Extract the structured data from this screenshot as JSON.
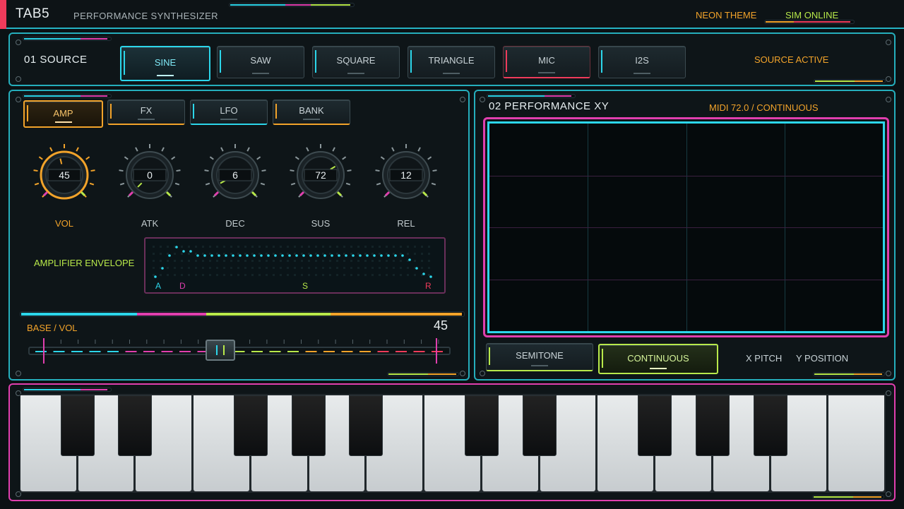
{
  "header": {
    "title": "TAB5",
    "subtitle": "PERFORMANCE SYNTHESIZER",
    "theme": "NEON THEME",
    "status": "SIM ONLINE"
  },
  "source": {
    "section": "01  SOURCE",
    "buttons": [
      "SINE",
      "SAW",
      "SQUARE",
      "TRIANGLE",
      "MIC",
      "I2S"
    ],
    "selected": "SINE",
    "status": "SOURCE ACTIVE"
  },
  "tabs": {
    "items": [
      "AMP",
      "FX",
      "LFO",
      "BANK"
    ],
    "selected": "AMP"
  },
  "knobs": [
    {
      "label": "VOL",
      "value": "45"
    },
    {
      "label": "ATK",
      "value": "0"
    },
    {
      "label": "DEC",
      "value": "6"
    },
    {
      "label": "SUS",
      "value": "72"
    },
    {
      "label": "REL",
      "value": "12"
    }
  ],
  "envelope": {
    "label": "AMPLIFIER ENVELOPE",
    "markers": [
      "A",
      "D",
      "S",
      "R"
    ]
  },
  "base": {
    "label": "BASE  /  VOL",
    "value": "45",
    "slider_fraction": 0.45
  },
  "performance": {
    "section": "02  PERFORMANCE XY",
    "midi": "MIDI 72.0  /  CONTINUOUS",
    "modes": [
      "SEMITONE",
      "CONTINUOUS"
    ],
    "selected_mode": "CONTINUOUS",
    "x_axis": "X PITCH",
    "y_axis": "Y POSITION"
  },
  "colors": {
    "cyan": "#2cd6ea",
    "magenta": "#e03fae",
    "lime": "#b8e94a",
    "orange": "#f2a32a",
    "red": "#ef3b5b"
  }
}
